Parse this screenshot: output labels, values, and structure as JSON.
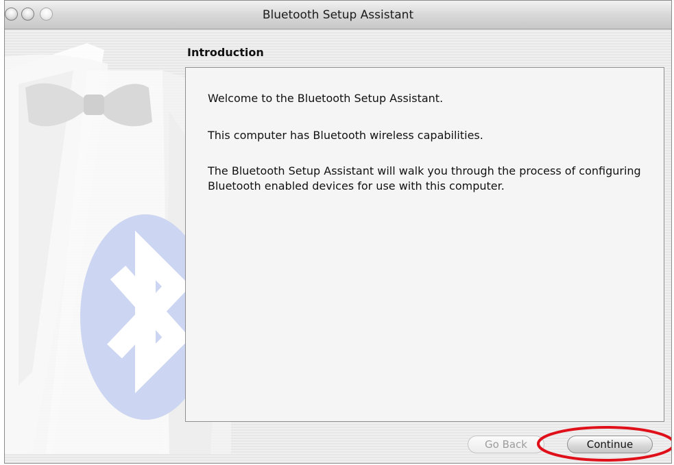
{
  "window": {
    "title": "Bluetooth Setup Assistant"
  },
  "page": {
    "section_title": "Introduction",
    "paragraphs": [
      "Welcome to the Bluetooth Setup Assistant.",
      "This computer has Bluetooth wireless capabilities.",
      "The Bluetooth Setup Assistant will walk you through the process of configuring Bluetooth enabled devices for use with this computer."
    ]
  },
  "buttons": {
    "go_back": "Go Back",
    "continue": "Continue"
  },
  "colors": {
    "highlight_ring": "#e0101a",
    "bluetooth_badge": "#c9d3f0"
  },
  "icons": {
    "bluetooth": "bluetooth-icon",
    "close": "close-window-icon",
    "minimize": "minimize-window-icon",
    "zoom": "zoom-window-icon"
  }
}
